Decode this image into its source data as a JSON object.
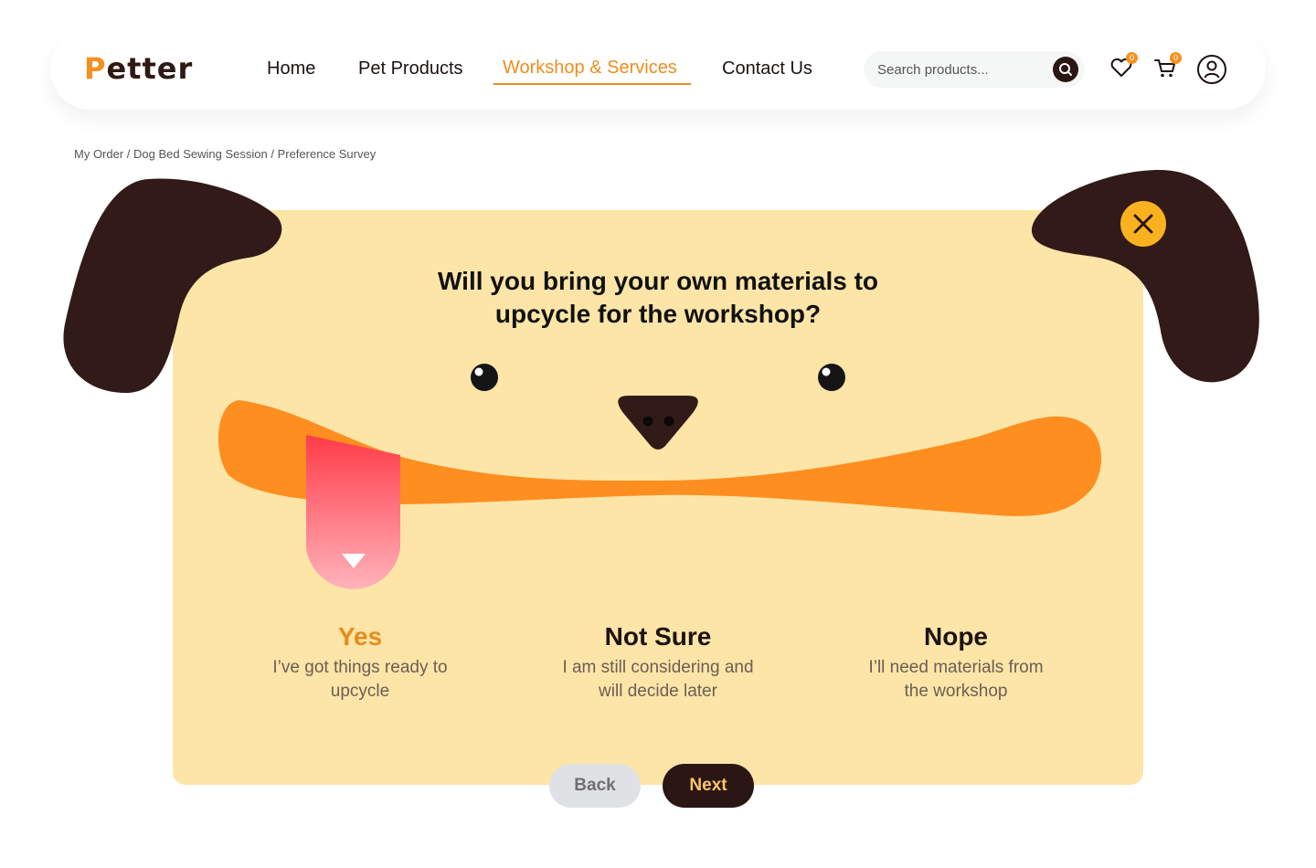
{
  "brand": {
    "logo_text": "etter",
    "logo_initial": "P"
  },
  "nav": {
    "items": [
      {
        "label": "Home"
      },
      {
        "label": "Pet Products"
      },
      {
        "label": "Workshop & Services",
        "active": true
      },
      {
        "label": "Contact Us"
      }
    ]
  },
  "search": {
    "placeholder": "Search products..."
  },
  "header_icons": {
    "wishlist": {
      "icon": "heart-icon",
      "count": "0"
    },
    "cart": {
      "icon": "cart-icon",
      "count": "0"
    },
    "account": {
      "icon": "user-icon"
    }
  },
  "breadcrumb": {
    "items": [
      "My Order",
      "Dog Bed Sewing Session",
      "Preference Survey"
    ],
    "separator": " / "
  },
  "survey": {
    "question_line1": "Will you bring your own materials to",
    "question_line2": "upcycle for the workshop?",
    "options": [
      {
        "title": "Yes",
        "desc_line1": "I’ve got things ready to",
        "desc_line2": "upcycle",
        "selected": true
      },
      {
        "title": "Not Sure",
        "desc_line1": "I am still considering and",
        "desc_line2": "will decide later",
        "selected": false
      },
      {
        "title": "Nope",
        "desc_line1": "I’ll need materials from",
        "desc_line2": "the workshop",
        "selected": false
      }
    ]
  },
  "actions": {
    "back_label": "Back",
    "next_label": "Next"
  },
  "colors": {
    "accent": "#f08b1f",
    "brown": "#2f1914",
    "card": "#fde5a7",
    "mouth": "#fe8e1f",
    "tongue_top": "#ff3b48",
    "tongue_bottom": "#ffb3bb",
    "close": "#f9b21f"
  }
}
